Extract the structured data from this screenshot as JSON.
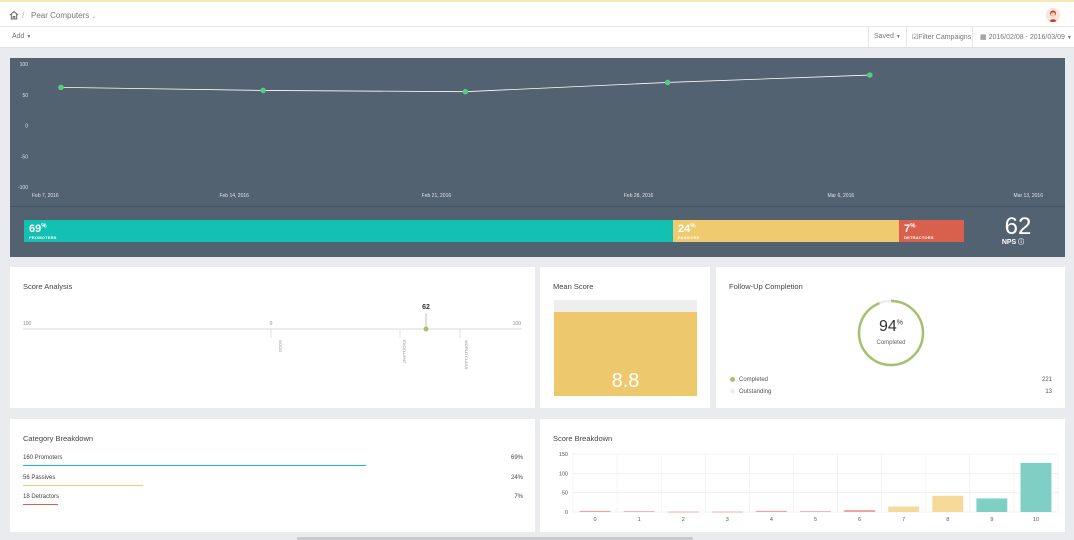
{
  "topbar": {
    "breadcrumb": "Pear Computers"
  },
  "toolbar": {
    "add_label": "Add",
    "saved_label": "Saved",
    "filter_label": "Filter Campaigns",
    "date_range": "2016/02/08 - 2016/03/09"
  },
  "trend": {
    "y_ticks": [
      "100",
      "50",
      "0",
      "-50",
      "-100"
    ],
    "x_ticks": [
      "Feb 7, 2016",
      "Feb 14, 2016",
      "Feb 21, 2016",
      "Feb 28, 2016",
      "Mar 6, 2016",
      "Mar 13, 2016"
    ],
    "colors": {
      "line": "#ffffff",
      "point": "#5ac983",
      "background": "#526270"
    }
  },
  "nps_bar": {
    "promoters": {
      "pct": "69",
      "sign": "%",
      "label": "PROMOTERS",
      "color": "#13c1b2"
    },
    "passives": {
      "pct": "24",
      "sign": "%",
      "label": "PASSIVES",
      "color": "#efca6f"
    },
    "detractors": {
      "pct": "7",
      "sign": "%",
      "label": "DETRACTORS",
      "color": "#d9604d"
    },
    "score": "62",
    "score_label": "NPS"
  },
  "score_analysis": {
    "title": "Score Analysis",
    "marker_value": "62",
    "scale_labels": [
      "100",
      "0",
      "100"
    ],
    "zone_labels": [
      "GOOD",
      "EXCELLENT",
      "WORLD CLASS"
    ]
  },
  "mean_score": {
    "title": "Mean Score",
    "value": "8.8",
    "max": 10
  },
  "followup": {
    "title": "Follow-Up Completion",
    "pct": "94",
    "pct_sign": "%",
    "sub": "Completed",
    "completed_label": "Completed",
    "completed_count": "221",
    "outstanding_label": "Outstanding",
    "outstanding_count": "13",
    "colors": {
      "completed": "#a5c06f",
      "outstanding": "#eeeeee"
    }
  },
  "category": {
    "title": "Category Breakdown",
    "rows": [
      {
        "name": "160 Promoters",
        "value": "69%",
        "color": "#13c1b2"
      },
      {
        "name": "56 Passives",
        "value": "24%",
        "color": "#efca6f"
      },
      {
        "name": "18 Detractors",
        "value": "7%",
        "color": "#d9604d"
      }
    ]
  },
  "score_breakdown": {
    "title": "Score Breakdown"
  },
  "chart_data": [
    {
      "type": "line",
      "x": [
        "Feb 7, 2016",
        "Feb 14, 2016",
        "Feb 21, 2016",
        "Feb 28, 2016",
        "Mar 6, 2016"
      ],
      "values": [
        62,
        57,
        55,
        70,
        82
      ],
      "ylim": [
        -100,
        100
      ],
      "x_ticks": [
        "Feb 7, 2016",
        "Feb 14, 2016",
        "Feb 21, 2016",
        "Feb 28, 2016",
        "Mar 6, 2016",
        "Mar 13, 2016"
      ],
      "y_ticks": [
        100,
        50,
        0,
        -50,
        -100
      ],
      "grid": false
    },
    {
      "type": "bar",
      "categories": [
        "0",
        "1",
        "2",
        "3",
        "4",
        "5",
        "6",
        "7",
        "8",
        "9",
        "10"
      ],
      "values": [
        3,
        2,
        1,
        1,
        3,
        2,
        5,
        14,
        42,
        35,
        127
      ],
      "ylim": [
        0,
        150
      ],
      "y_ticks": [
        0,
        50,
        100,
        150
      ],
      "colors": [
        "#f0a1a1",
        "#f0a1a1",
        "#f0a1a1",
        "#f0a1a1",
        "#f0a1a1",
        "#f0a1a1",
        "#f0a1a1",
        "#f7d99a",
        "#f7d99a",
        "#7fcfc5",
        "#7fcfc5"
      ],
      "grid": true
    }
  ]
}
